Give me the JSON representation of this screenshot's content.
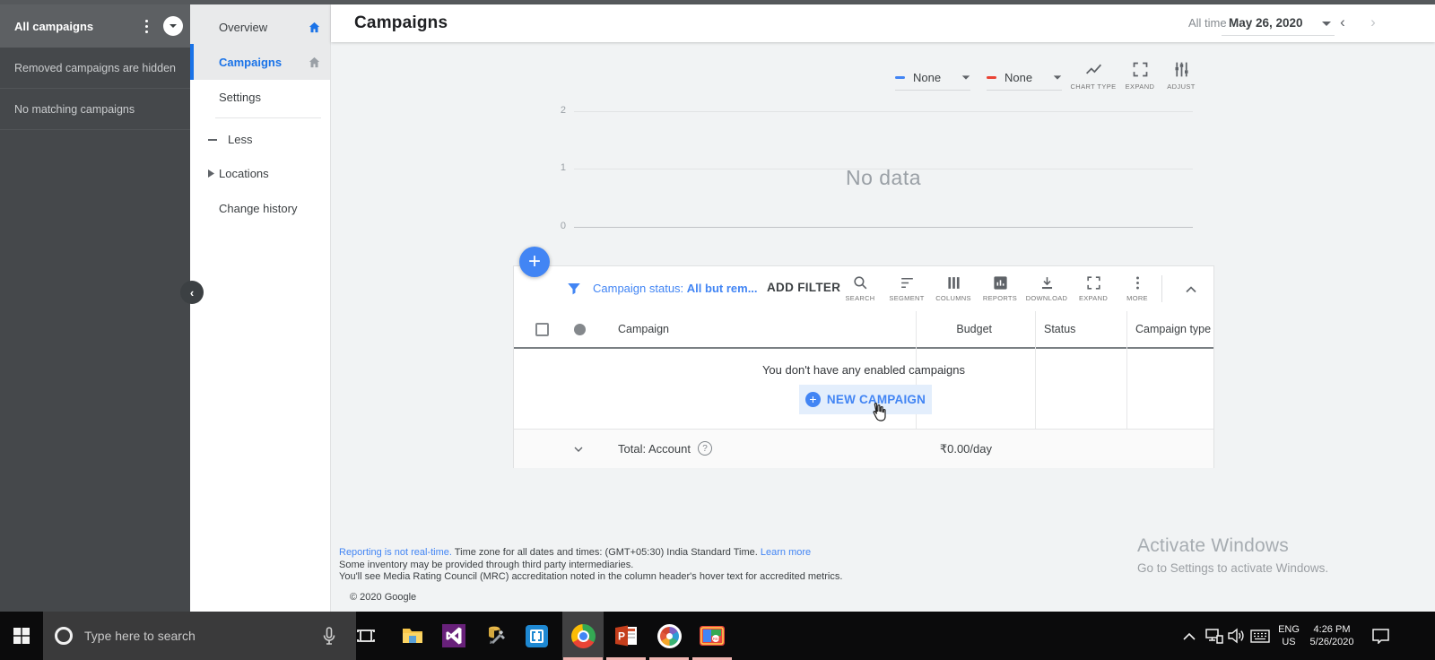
{
  "sidebar": {
    "title": "All campaigns",
    "rows": [
      "Removed campaigns are hidden",
      "No matching campaigns"
    ]
  },
  "nav": {
    "items": [
      {
        "label": "Overview"
      },
      {
        "label": "Campaigns"
      },
      {
        "label": "Settings"
      },
      {
        "label": "Less"
      },
      {
        "label": "Locations"
      },
      {
        "label": "Change history"
      }
    ]
  },
  "header": {
    "title": "Campaigns",
    "range_label": "All time",
    "date_value": "May 26, 2020"
  },
  "toolbar": {
    "metric1": "None",
    "metric2": "None",
    "metric1_color": "#4285f4",
    "metric2_color": "#ea4335",
    "chart_type_label": "CHART TYPE",
    "expand_label": "EXPAND",
    "adjust_label": "ADJUST"
  },
  "chart_data": {
    "type": "line",
    "series": [],
    "x": [],
    "title": "",
    "xlabel": "",
    "ylabel": "",
    "ylim": [
      0,
      2
    ],
    "yticks": [
      "2",
      "1",
      "0"
    ],
    "grid": true,
    "empty_message": "No data"
  },
  "filter_bar": {
    "status_label": "Campaign status:",
    "status_value": "All but rem...",
    "add_filter": "ADD FILTER",
    "actions": [
      {
        "name": "search",
        "label": "SEARCH"
      },
      {
        "name": "segment",
        "label": "SEGMENT"
      },
      {
        "name": "columns",
        "label": "COLUMNS"
      },
      {
        "name": "reports",
        "label": "REPORTS"
      },
      {
        "name": "download",
        "label": "DOWNLOAD"
      },
      {
        "name": "expand",
        "label": "EXPAND"
      },
      {
        "name": "more",
        "label": "MORE"
      }
    ]
  },
  "table": {
    "columns": [
      "Campaign",
      "Budget",
      "Status",
      "Campaign type"
    ],
    "empty_message": "You don't have any enabled campaigns",
    "new_campaign_label": "NEW CAMPAIGN",
    "total_label": "Total: Account",
    "total_budget": "₹0.00/day"
  },
  "footer": {
    "link1": "Reporting is not real-time.",
    "line1": " Time zone for all dates and times: (GMT+05:30) India Standard Time. ",
    "link2": "Learn more",
    "line2": "Some inventory may be provided through third party intermediaries.",
    "line3": "You'll see Media Rating Council (MRC) accreditation noted in the column header's hover text for accredited metrics.",
    "copyright": "© 2020 Google"
  },
  "watermark": {
    "title": "Activate Windows",
    "subtitle": "Go to Settings to activate Windows."
  },
  "taskbar": {
    "search_placeholder": "Type here to search",
    "tray": {
      "lang": "ENG",
      "region": "US",
      "time": "4:26 PM",
      "date": "5/26/2020"
    }
  },
  "colors": {
    "accent_blue": "#4285f4",
    "link_blue": "#1a73e8",
    "metric_red": "#ea4335",
    "sidebar_dark": "#45484b",
    "content_bg": "#f1f3f4"
  }
}
